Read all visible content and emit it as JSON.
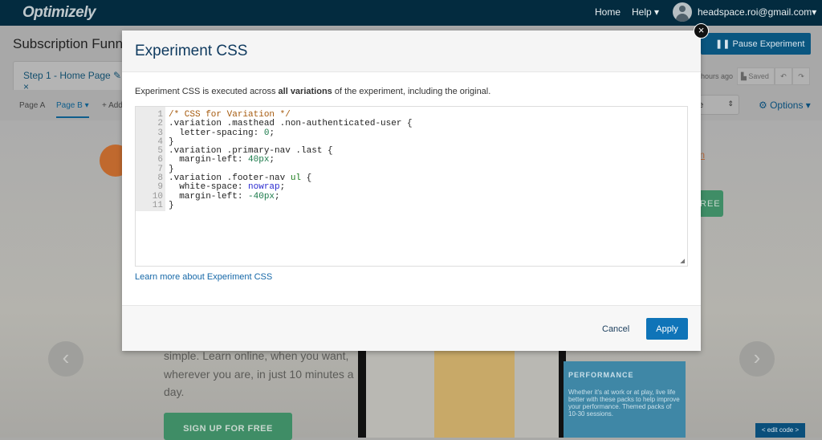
{
  "topnav": {
    "logo": "Optimizely",
    "home": "Home",
    "help": "Help ▾",
    "user": "headspace.roi@gmail.com▾"
  },
  "header": {
    "title": "Subscription Funne",
    "step_tab": "Step 1 - Home Page ✎ ×",
    "pages": [
      "Page A",
      "Page B ▾",
      "+ Add"
    ],
    "pause": "❚❚ Pause Experiment",
    "saved_ago": "hours ago",
    "saved": "Saved",
    "undo": "↶",
    "redo": "↷",
    "select_value": "de",
    "options": "⚙ Options ▾"
  },
  "preview": {
    "login": "g In",
    "free": "REE",
    "text": "simple. Learn online, when you want, wherever you are, in just 10 minutes a day.",
    "signup": "SIGN UP FOR FREE",
    "performance_title": "PERFORMANCE",
    "performance_text": "Whether it's at work or at play, live life better with these packs to help improve your performance. Themed packs of 10-30 sessions.",
    "prev": "‹",
    "next": "›",
    "edit_code": "< edit code >"
  },
  "modal": {
    "title": "Experiment CSS",
    "desc_pre": "Experiment CSS is executed across ",
    "desc_bold": "all variations",
    "desc_post": " of the experiment, including the original.",
    "line_numbers": "1\n2\n3\n4\n5\n6\n7\n8\n9\n10\n11",
    "learn_more": "Learn more about Experiment CSS",
    "cancel": "Cancel",
    "apply": "Apply",
    "close": "×"
  }
}
